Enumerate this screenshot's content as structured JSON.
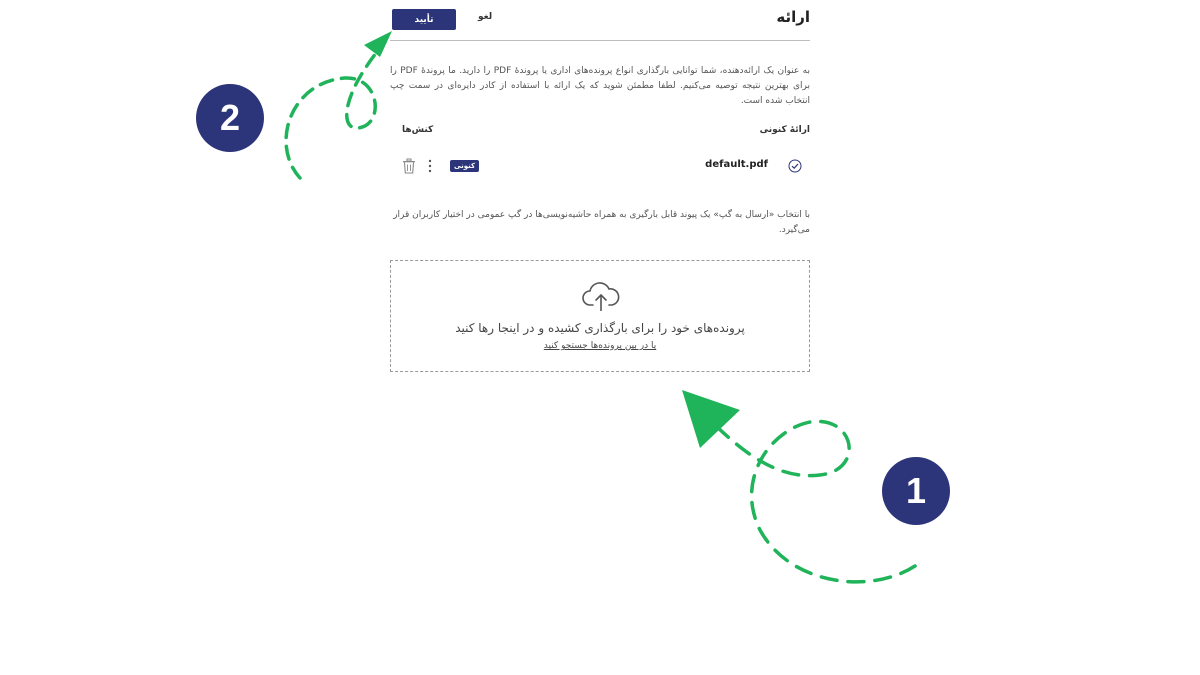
{
  "dialog": {
    "title": "ارائه",
    "confirm_label": "تأیید",
    "cancel_label": "لغو",
    "description": "به عنوان یک ارائه‌دهنده، شما توانایی بارگذاری انواع پرونده‌های اداری یا پروندهٔ PDF را دارید. ما پروندهٔ PDF را برای بهترین نتیجه توصیه می‌کنیم. لطفا مطمئن شوید که یک ارائه با استفاده از کادر دایره‌ای در سمت چپ انتخاب شده است.",
    "col_current": "ارائهٔ کنونی",
    "col_actions": "کنش‌ها",
    "file": {
      "name": "default.pdf",
      "badge": "کنونی"
    },
    "note": "با انتخاب «ارسال به گپ» یک پیوند قابل بارگیری به همراه حاشیه‌نویسی‌ها در گپ عمومی در اختیار کاربران قرار می‌گیرد.",
    "dropzone": {
      "text": "پرونده‌های خود را برای بارگذاری کشیده و در اینجا رها کنید",
      "link": "یا در بین پرونده‌ها جستجو کنید"
    }
  },
  "steps": {
    "one": "1",
    "two": "2"
  },
  "colors": {
    "primary": "#2c3579",
    "arrow": "#1fb35a"
  },
  "icons": [
    "check-circle-icon",
    "kebab-menu-icon",
    "trash-icon",
    "cloud-upload-icon",
    "dashed-arrow-icon"
  ]
}
